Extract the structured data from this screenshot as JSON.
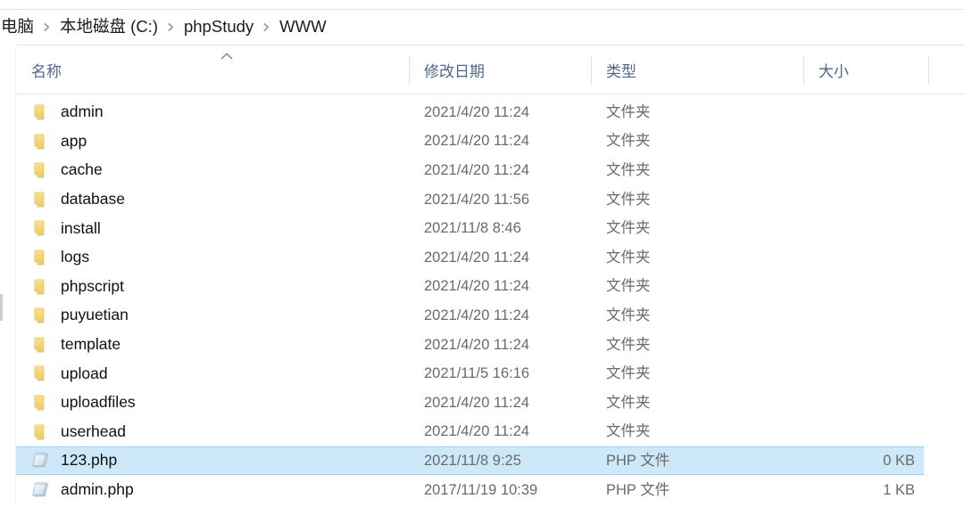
{
  "window": {
    "app": "file-explorer",
    "accent_selection_bg": "#cce8f9",
    "accent_selection_border": "#9dd3ef",
    "header_text_color": "#51678a"
  },
  "breadcrumb": {
    "separator": "chevron-right",
    "items": [
      {
        "label": "电脑"
      },
      {
        "label": "本地磁盘 (C:)"
      },
      {
        "label": "phpStudy"
      },
      {
        "label": "WWW"
      }
    ]
  },
  "columns": {
    "sort_indicator": "ascending-caret",
    "headers": [
      {
        "key": "name",
        "label": "名称"
      },
      {
        "key": "date",
        "label": "修改日期"
      },
      {
        "key": "type",
        "label": "类型"
      },
      {
        "key": "size",
        "label": "大小"
      }
    ]
  },
  "files": {
    "rows": [
      {
        "name": "admin",
        "date": "2021/4/20 11:24",
        "type": "文件夹",
        "size": "",
        "icon": "folder-icon",
        "selected": false
      },
      {
        "name": "app",
        "date": "2021/4/20 11:24",
        "type": "文件夹",
        "size": "",
        "icon": "folder-icon",
        "selected": false
      },
      {
        "name": "cache",
        "date": "2021/4/20 11:24",
        "type": "文件夹",
        "size": "",
        "icon": "folder-icon",
        "selected": false
      },
      {
        "name": "database",
        "date": "2021/4/20 11:56",
        "type": "文件夹",
        "size": "",
        "icon": "folder-icon",
        "selected": false
      },
      {
        "name": "install",
        "date": "2021/11/8 8:46",
        "type": "文件夹",
        "size": "",
        "icon": "folder-icon",
        "selected": false
      },
      {
        "name": "logs",
        "date": "2021/4/20 11:24",
        "type": "文件夹",
        "size": "",
        "icon": "folder-icon",
        "selected": false
      },
      {
        "name": "phpscript",
        "date": "2021/4/20 11:24",
        "type": "文件夹",
        "size": "",
        "icon": "folder-icon",
        "selected": false
      },
      {
        "name": "puyuetian",
        "date": "2021/4/20 11:24",
        "type": "文件夹",
        "size": "",
        "icon": "folder-icon",
        "selected": false
      },
      {
        "name": "template",
        "date": "2021/4/20 11:24",
        "type": "文件夹",
        "size": "",
        "icon": "folder-icon",
        "selected": false
      },
      {
        "name": "upload",
        "date": "2021/11/5 16:16",
        "type": "文件夹",
        "size": "",
        "icon": "folder-icon",
        "selected": false
      },
      {
        "name": "uploadfiles",
        "date": "2021/4/20 11:24",
        "type": "文件夹",
        "size": "",
        "icon": "folder-icon",
        "selected": false
      },
      {
        "name": "userhead",
        "date": "2021/4/20 11:24",
        "type": "文件夹",
        "size": "",
        "icon": "folder-icon",
        "selected": false
      },
      {
        "name": "123.php",
        "date": "2021/11/8 9:25",
        "type": "PHP 文件",
        "size": "0 KB",
        "icon": "php-file-icon",
        "selected": true
      },
      {
        "name": "admin.php",
        "date": "2017/11/19 10:39",
        "type": "PHP 文件",
        "size": "1 KB",
        "icon": "php-file-icon",
        "selected": false
      }
    ]
  }
}
